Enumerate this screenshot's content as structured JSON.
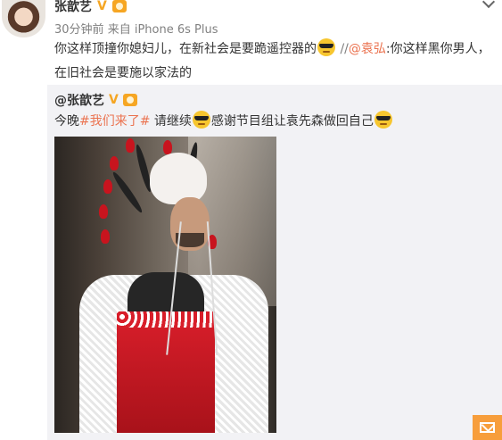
{
  "post": {
    "author": "张歆艺",
    "verified_mark": "V",
    "time_ago": "30分钟前",
    "source_prefix": "来自",
    "device": "iPhone 6s Plus",
    "text_part1": "你这样顶撞你媳妇儿，在新社会是要跪遥控器的",
    "repost_prefix": " //",
    "mention": "@袁弘",
    "text_part2": ":你这样黑你男人，在旧社会是要施以家法的"
  },
  "original": {
    "author": "@张歆艺",
    "text_lead": "今晚",
    "hashtag": "#我们来了#",
    "text_mid": " 请继续",
    "text_end": "感谢节目组让袁先森做回自己"
  },
  "icons": {
    "verified": "verified-v-icon",
    "level": "member-level-icon",
    "emoji": "cool-sunglasses-emoji",
    "more": "chevron-down-icon",
    "mail": "mail-icon"
  },
  "colors": {
    "link": "#eb7350",
    "verified": "#f5a623",
    "original_bg": "#f2f2f5",
    "mail_button": "#f79e3c"
  }
}
